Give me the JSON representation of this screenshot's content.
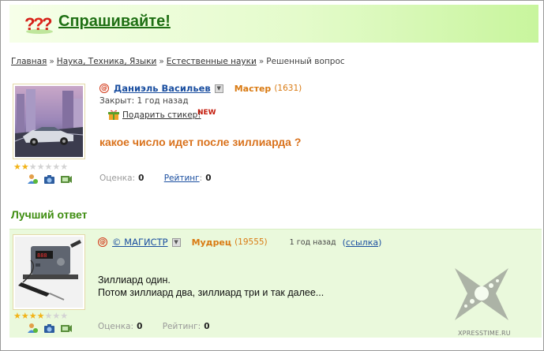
{
  "header": {
    "title": "Спрашивайте!"
  },
  "breadcrumb": {
    "items": [
      "Главная",
      "Наука, Техника, Языки",
      "Естественные науки"
    ],
    "current": "Решенный вопрос",
    "separator": "»"
  },
  "question": {
    "author": "Даниэль Васильев",
    "rank": "Мастер",
    "points": "(1631)",
    "closed": "Закрыт: 1 год назад",
    "gift_label": "Подарить стикер!",
    "new_badge": "NEW",
    "title": "какое число идет после зиллиарда ?",
    "stars_filled": 2,
    "stars_total": 7,
    "score_label": "Оценка:",
    "score_value": "0",
    "rating_label": "Рейтинг",
    "rating_value": "0"
  },
  "best_answer": {
    "heading": "Лучший ответ",
    "author": "© МАГИСТР",
    "rank": "Мудрец",
    "points": "(19555)",
    "time": "1 год назад",
    "link_label": "ссылка",
    "text_line1": "Зиллиард один.",
    "text_line2": "Потом зиллиард два, зиллиард три и так далее...",
    "stars_filled": 4,
    "stars_total": 7,
    "score_label": "Оценка:",
    "score_value": "0",
    "rating_label": "Рейтинг:",
    "rating_value": "0"
  },
  "watermark": {
    "text": "XPRESSTIME.RU"
  },
  "colors": {
    "accent_green": "#1e6f13",
    "heading_green": "#3e8d10",
    "question_orange": "#d9711b",
    "rank_orange": "#d97a12",
    "link_blue": "#1b4fa0"
  },
  "icons": [
    "question-marks-logo-icon",
    "at-icon",
    "dropdown-icon",
    "gift-icon",
    "user-icon",
    "camera-icon",
    "video-icon",
    "star-icon"
  ]
}
